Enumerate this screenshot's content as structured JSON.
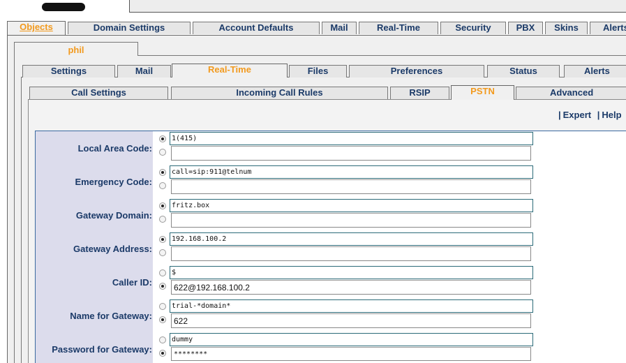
{
  "tabs_level1": [
    {
      "label": "Objects",
      "active": true
    },
    {
      "label": "Domain Settings",
      "active": false
    },
    {
      "label": "Account Defaults",
      "active": false
    },
    {
      "label": "Mail",
      "active": false
    },
    {
      "label": "Real-Time",
      "active": false
    },
    {
      "label": "Security",
      "active": false
    },
    {
      "label": "PBX",
      "active": false
    },
    {
      "label": "Skins",
      "active": false
    },
    {
      "label": "Alerts",
      "active": false
    }
  ],
  "account_tab": {
    "label": "phil"
  },
  "tabs_level3": [
    {
      "label": "Settings",
      "active": false
    },
    {
      "label": "Mail",
      "active": false
    },
    {
      "label": "Real-Time",
      "active": true
    },
    {
      "label": "Files",
      "active": false
    },
    {
      "label": "Preferences",
      "active": false
    },
    {
      "label": "Status",
      "active": false
    },
    {
      "label": "Alerts",
      "active": false
    }
  ],
  "tabs_level4": [
    {
      "label": "Call Settings",
      "active": false
    },
    {
      "label": "Incoming Call Rules",
      "active": false
    },
    {
      "label": "RSIP",
      "active": false
    },
    {
      "label": "PSTN",
      "active": true
    },
    {
      "label": "Advanced",
      "active": false
    }
  ],
  "links": {
    "separator": "|",
    "expert": "Expert",
    "help": "Help"
  },
  "form": {
    "rows": [
      {
        "label": "Local Area Code:",
        "default_value": "1(415)",
        "custom_value": "",
        "default_selected": true
      },
      {
        "label": "Emergency Code:",
        "default_value": "call=sip:911@telnum",
        "custom_value": "",
        "default_selected": true
      },
      {
        "label": "Gateway Domain:",
        "default_value": "fritz.box",
        "custom_value": "",
        "default_selected": true
      },
      {
        "label": "Gateway Address:",
        "default_value": "192.168.100.2",
        "custom_value": "",
        "default_selected": true
      },
      {
        "label": "Caller ID:",
        "default_value": "$",
        "custom_value": "622@192.168.100.2",
        "default_selected": false
      },
      {
        "label": "Name for Gateway:",
        "default_value": "trial-*domain*",
        "custom_value": "622",
        "default_selected": false
      },
      {
        "label": "Password for Gateway:",
        "default_value": "dummy",
        "custom_value": "********",
        "default_selected": false
      }
    ]
  },
  "colors": {
    "active_tab_text": "#f29a1e",
    "tab_text": "#1b3a68",
    "label_column": "#dcdcec",
    "form_border": "#3b6aa0"
  }
}
